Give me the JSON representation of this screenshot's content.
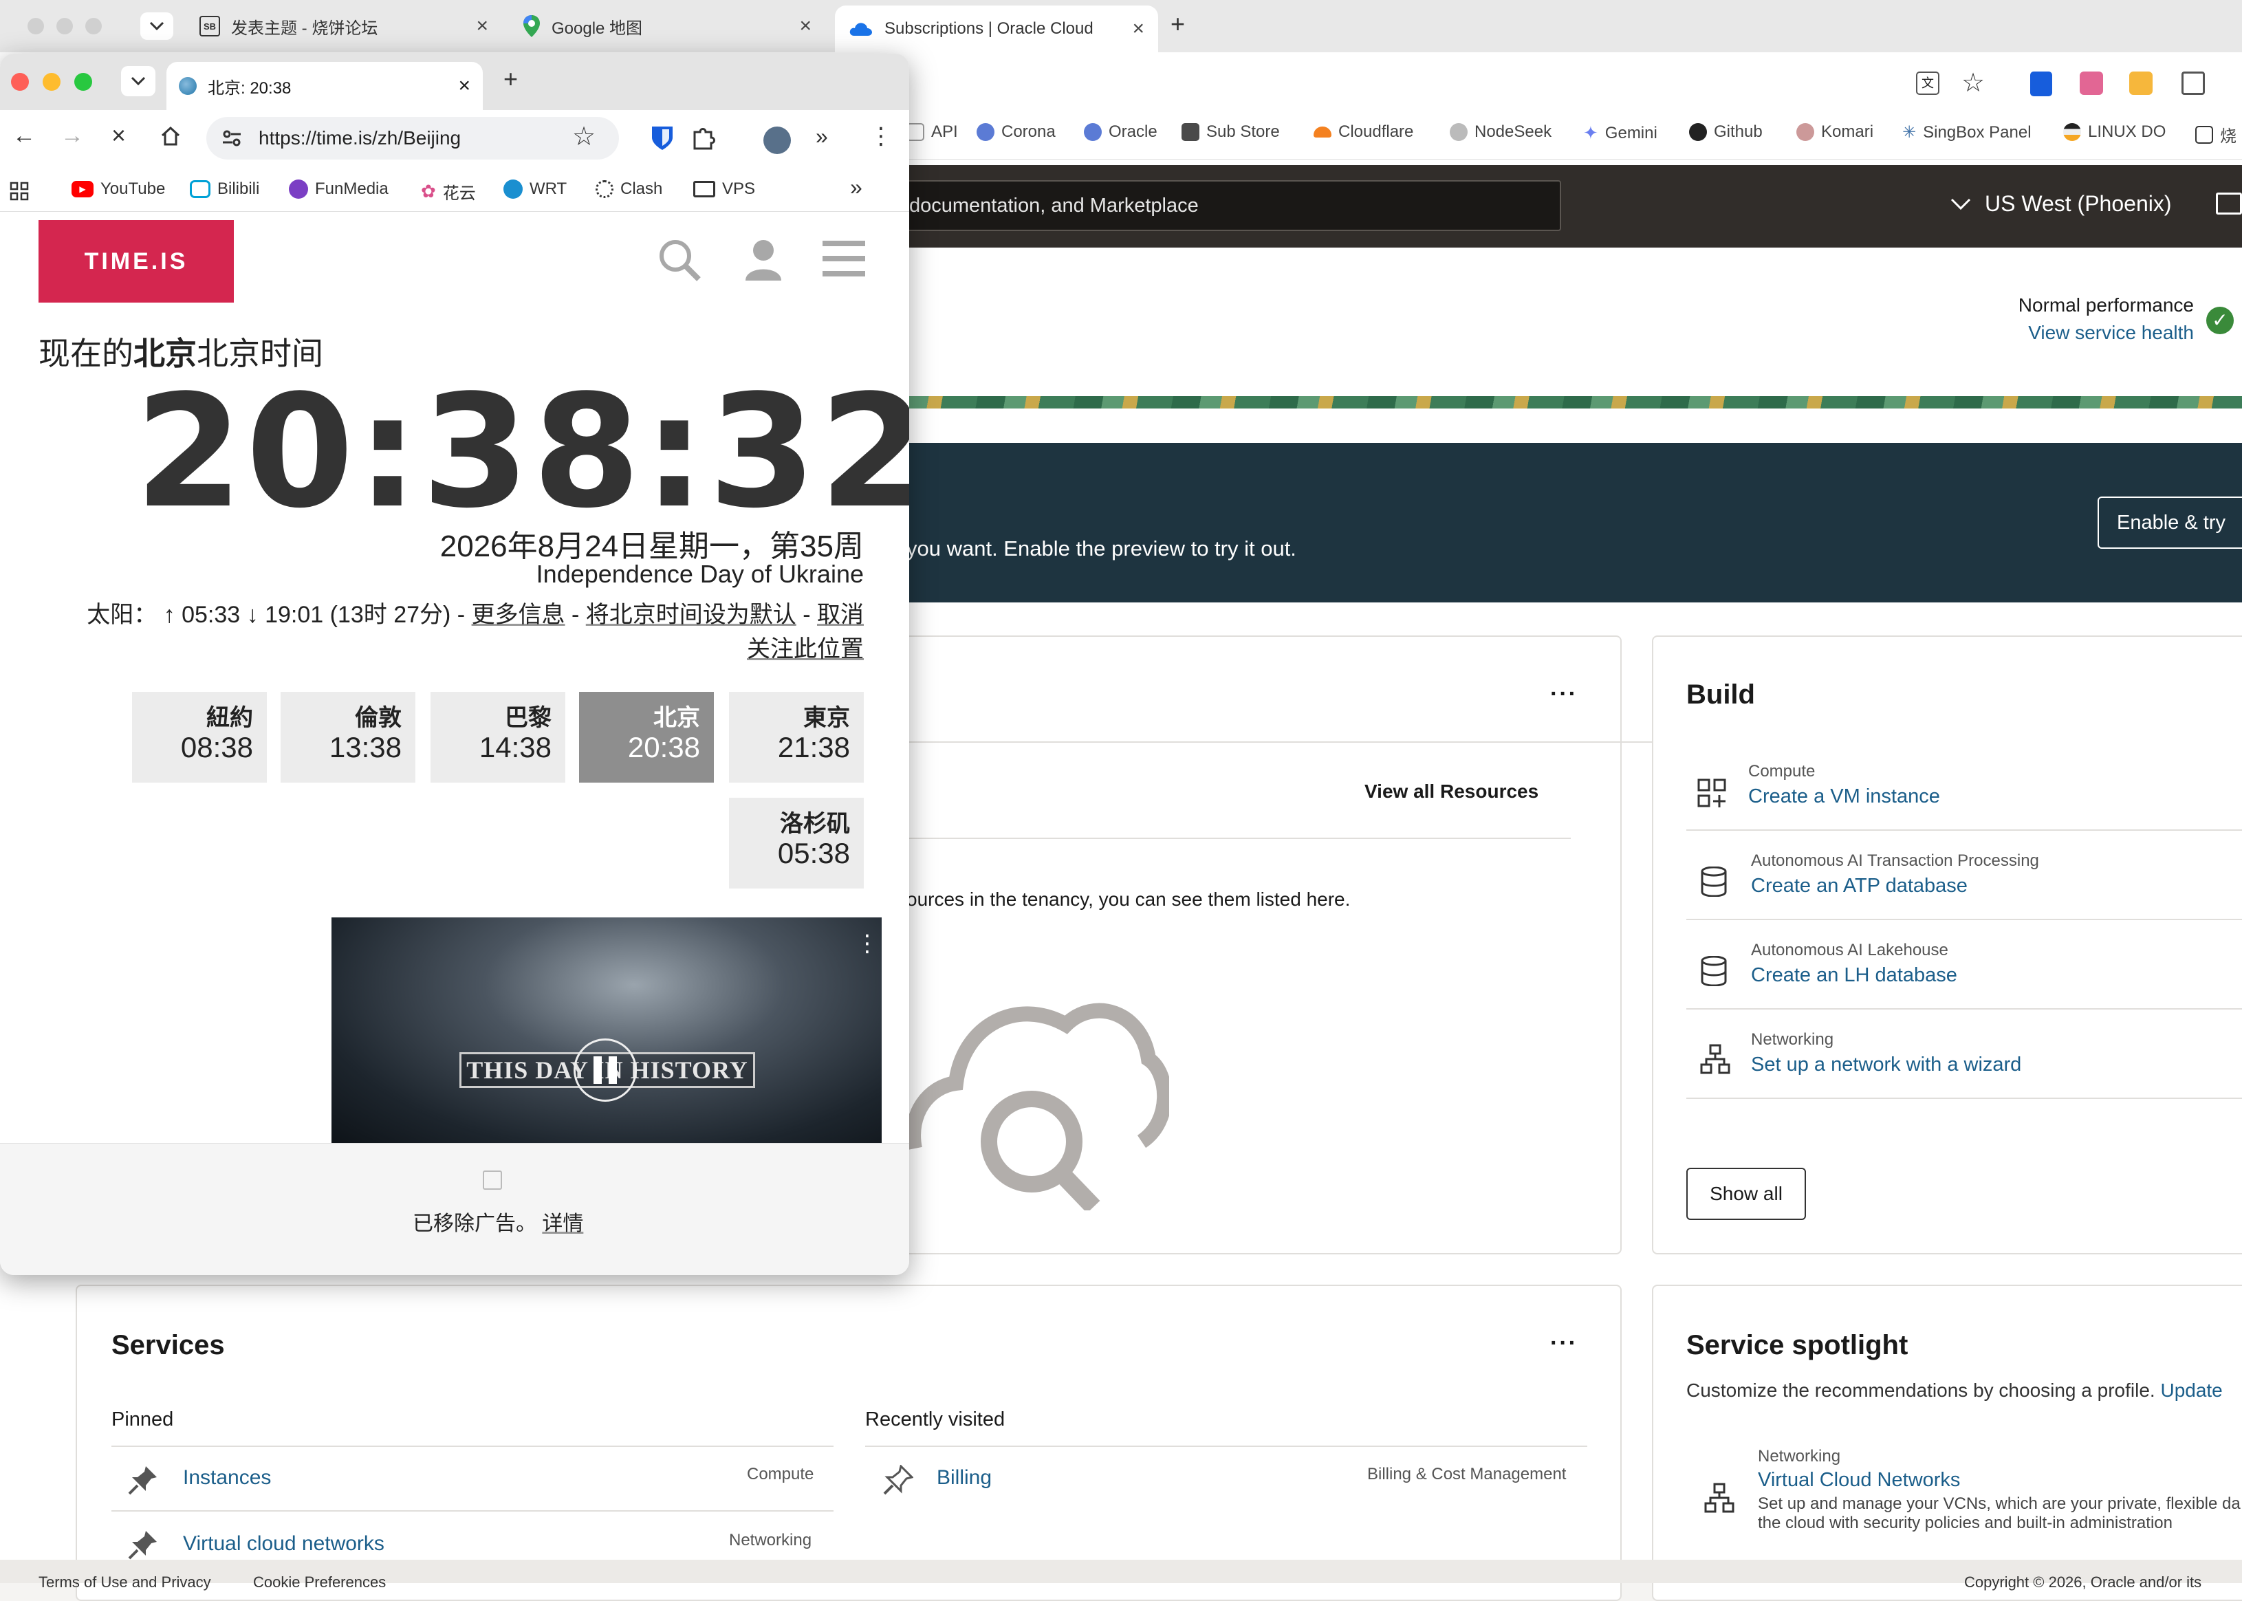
{
  "back_window": {
    "tabs": [
      {
        "title": "发表主题 - 烧饼论坛",
        "icon": "forum-icon"
      },
      {
        "title": "Google 地图",
        "icon": "maps-pin-icon"
      },
      {
        "title": "Subscriptions | Oracle Cloud",
        "icon": "cloud-icon"
      }
    ],
    "bookmarks": [
      "API",
      "Corona",
      "Oracle",
      "Sub Store",
      "Cloudflare",
      "NodeSeek",
      "Gemini",
      "Github",
      "Komari",
      "SingBox Panel",
      "LINUX DO",
      "烧"
    ],
    "search_placeholder": "documentation, and Marketplace",
    "region": "US West (Phoenix)",
    "health": {
      "status": "Normal performance",
      "link": "View service health"
    },
    "banner": {
      "text": "you want. Enable the preview to try it out.",
      "button": "Enable & try"
    },
    "resources": {
      "view_all": "View all Resources",
      "empty_text": "ources in the tenancy, you can see them listed here."
    },
    "build": {
      "title": "Build",
      "items": [
        {
          "category": "Compute",
          "link": "Create a VM instance",
          "icon": "grid-plus-icon"
        },
        {
          "category": "Autonomous AI Transaction Processing",
          "link": "Create an ATP database",
          "icon": "database-icon"
        },
        {
          "category": "Autonomous AI Lakehouse",
          "link": "Create an LH database",
          "icon": "database-icon"
        },
        {
          "category": "Networking",
          "link": "Set up a network with a wizard",
          "icon": "network-icon"
        }
      ],
      "show_all": "Show all"
    },
    "services": {
      "title": "Services",
      "pinned_label": "Pinned",
      "recent_label": "Recently visited",
      "pinned": [
        {
          "name": "Instances",
          "category": "Compute"
        },
        {
          "name": "Virtual cloud networks",
          "category": "Networking"
        }
      ],
      "recent": [
        {
          "name": "Billing",
          "category": "Billing & Cost Management"
        }
      ]
    },
    "spotlight": {
      "title": "Service spotlight",
      "desc": "Customize the recommendations by choosing a profile.",
      "update": "Update",
      "item_category": "Networking",
      "item_link": "Virtual Cloud Networks",
      "item_desc1": "Set up and manage your VCNs, which are your private, flexible da",
      "item_desc2": "the cloud with security policies and built-in administration"
    },
    "footer": {
      "left1": "Terms of Use and Privacy",
      "left2": "Cookie Preferences",
      "right": "Copyright © 2026, Oracle and/or its"
    }
  },
  "front_window": {
    "tab_title": "北京: 20:38",
    "url": "https://time.is/zh/Beijing",
    "bookmarks": [
      "YouTube",
      "Bilibili",
      "FunMedia",
      "花云",
      "WRT",
      "Clash",
      "VPS"
    ],
    "logo": "TIME.IS",
    "heading_prefix": "现在的",
    "heading_bold": "北京",
    "heading_suffix": "北京时间",
    "clock": "20:38:32",
    "date": "2026年8月24日星期一，第35周",
    "holiday": "Independence Day of Ukraine",
    "sun_label": "太阳：",
    "sunrise": "↑ 05:33",
    "sunset": "↓ 19:01 (13时 27分)",
    "sep": " - ",
    "more_info": "更多信息",
    "set_default": "将北京时间设为默认",
    "unfollow1": "取消",
    "unfollow2": "关注此位置",
    "cities": [
      {
        "name": "紐約",
        "time": "08:38"
      },
      {
        "name": "倫敦",
        "time": "13:38"
      },
      {
        "name": "巴黎",
        "time": "14:38"
      },
      {
        "name": "北京",
        "time": "20:38"
      },
      {
        "name": "東京",
        "time": "21:38"
      },
      {
        "name": "洛杉矶",
        "time": "05:38"
      }
    ],
    "video_caption": "THIS DAY IN HISTORY",
    "ad_removed": "已移除广告。",
    "ad_details": "详情"
  }
}
